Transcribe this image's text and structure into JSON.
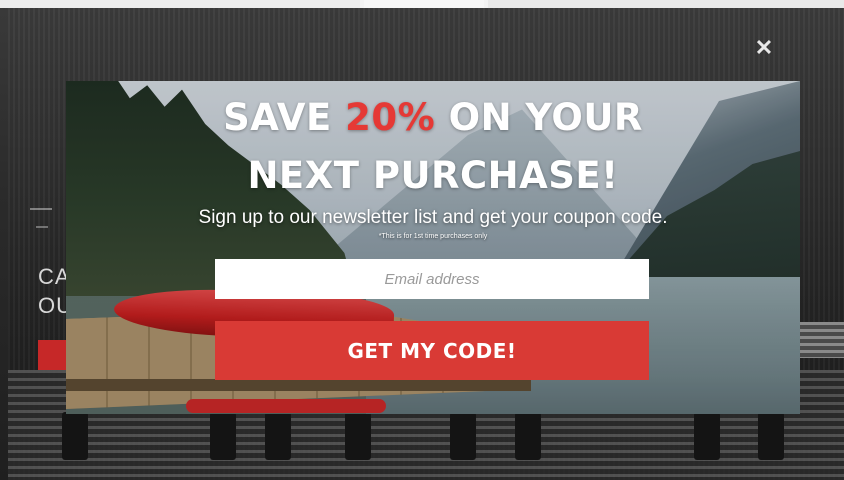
{
  "background_page": {
    "heading_partial": "CA\nOU"
  },
  "overlay": {
    "close_glyph": "✕"
  },
  "modal": {
    "headline_line1_pre": "SAVE ",
    "headline_line1_highlight": "20%",
    "headline_line1_post": " ON YOUR",
    "headline_line2": "NEXT PURCHASE!",
    "subtitle": "Sign up to our newsletter list and get your coupon code.",
    "fineprint": "*This is for 1st time purchases only",
    "email_placeholder": "Email address",
    "cta_label": "GET MY CODE!"
  },
  "colors": {
    "accent_red": "#e53935",
    "button_red": "#d93a35",
    "text_white": "#ffffff"
  },
  "icons": {
    "close": "close-icon"
  }
}
